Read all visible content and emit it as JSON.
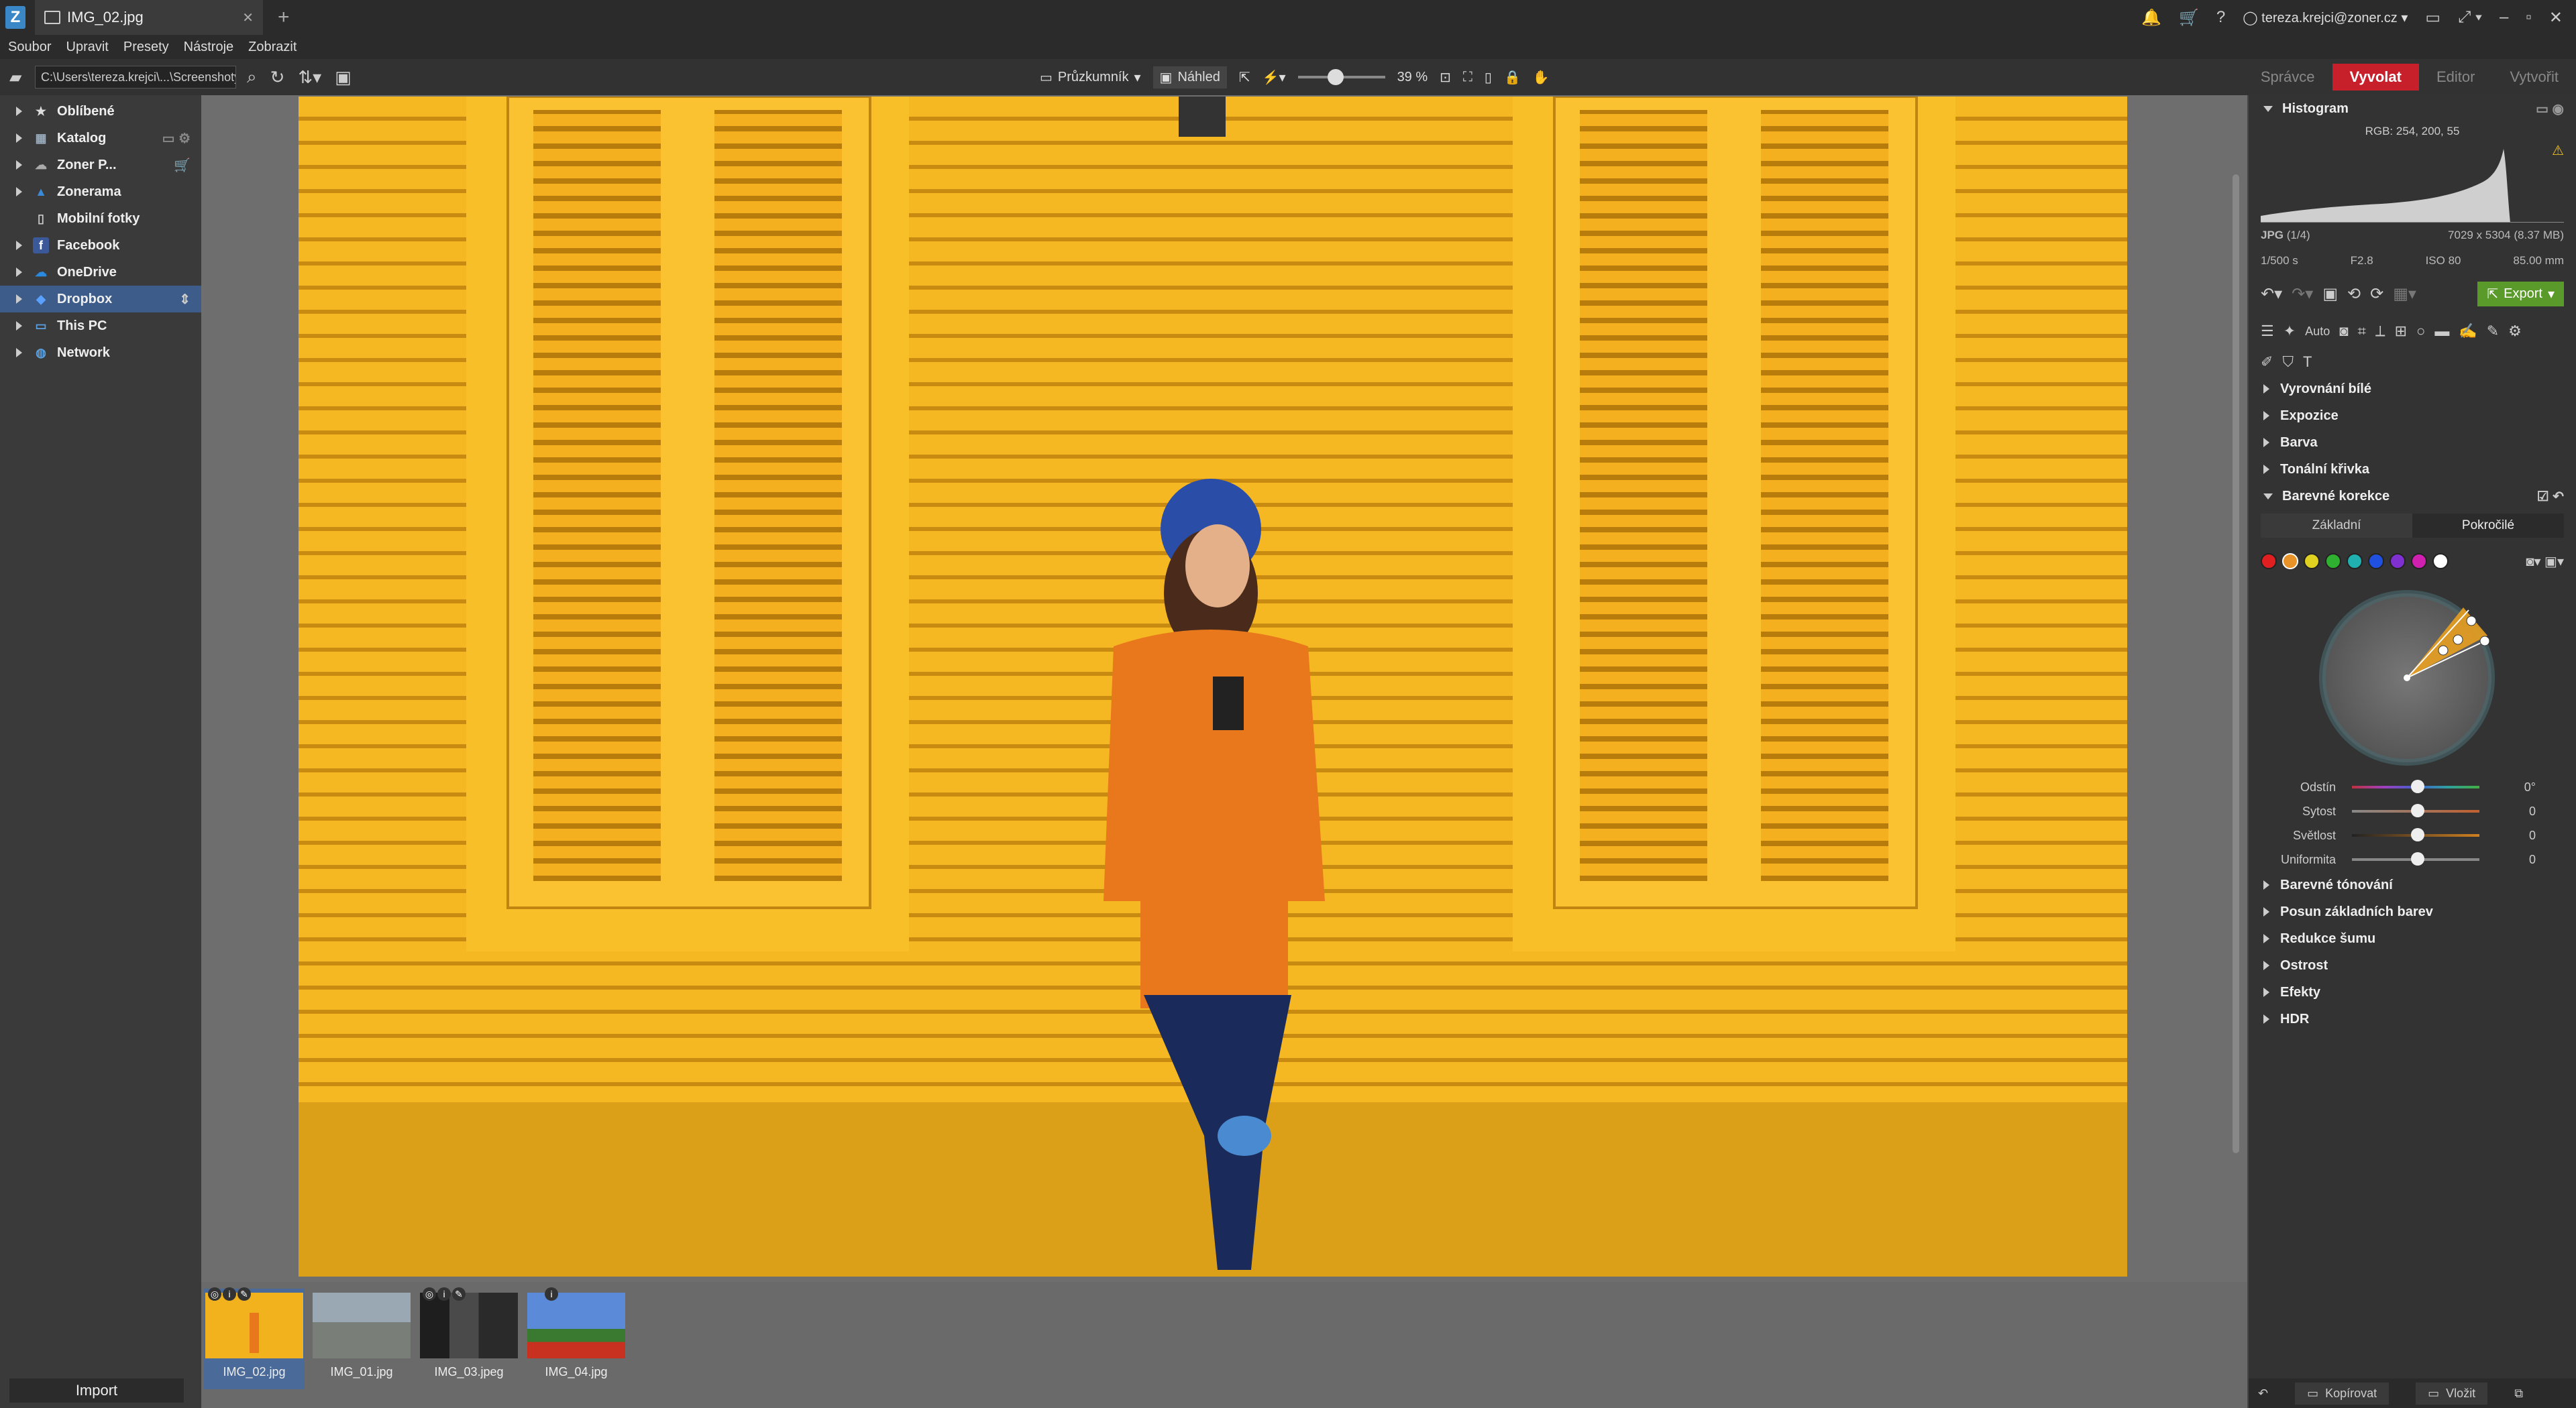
{
  "window": {
    "tab_title": "IMG_02.jpg",
    "user": "tereza.krejci@zoner.cz"
  },
  "menu": [
    "Soubor",
    "Upravit",
    "Presety",
    "Nástroje",
    "Zobrazit"
  ],
  "toolbar": {
    "path": "C:\\Users\\tereza.krejci\\...\\Screenshoty",
    "explorer_label": "Průzkumník",
    "preview_label": "Náhled",
    "zoom": "39 %"
  },
  "modes": [
    "Správce",
    "Vyvolat",
    "Editor",
    "Vytvořit"
  ],
  "active_mode": "Vyvolat",
  "navigator": [
    {
      "label": "Oblíbené",
      "icon": "star-icon"
    },
    {
      "label": "Katalog",
      "icon": "catalog-icon"
    },
    {
      "label": "Zoner P...",
      "icon": "cloud-icon"
    },
    {
      "label": "Zonerama",
      "icon": "zonerama-icon"
    },
    {
      "label": "Mobilní fotky",
      "icon": "phone-icon"
    },
    {
      "label": "Facebook",
      "icon": "facebook-icon"
    },
    {
      "label": "OneDrive",
      "icon": "onedrive-icon"
    },
    {
      "label": "Dropbox",
      "icon": "dropbox-icon"
    },
    {
      "label": "This PC",
      "icon": "pc-icon"
    },
    {
      "label": "Network",
      "icon": "network-icon"
    }
  ],
  "import_label": "Import",
  "filmstrip": [
    {
      "label": "IMG_02.jpg"
    },
    {
      "label": "IMG_01.jpg"
    },
    {
      "label": "IMG_03.jpeg"
    },
    {
      "label": "IMG_04.jpg"
    }
  ],
  "histogram": {
    "title": "Histogram",
    "rgb": "RGB: 254, 200, 55"
  },
  "file_info": {
    "type": "JPG",
    "index": "(1/4)",
    "dimensions": "7029 x 5304 (8.37 MB)",
    "shutter": "1/500 s",
    "aperture": "F2.8",
    "iso": "ISO 80",
    "focal": "85.00 mm"
  },
  "export_label": "Export",
  "auto_label": "Auto",
  "sections_top": [
    "Vyrovnání bílé",
    "Expozice",
    "Barva",
    "Tonální křivka"
  ],
  "color_correction": {
    "title": "Barevné korekce",
    "tab_basic": "Základní",
    "tab_advanced": "Pokročilé",
    "swatch_colors": [
      "#e02020",
      "#e8922a",
      "#e0d020",
      "#30b030",
      "#20b0b0",
      "#2050e0",
      "#8030d0",
      "#d020b0",
      "#ffffff"
    ],
    "sliders": [
      {
        "name": "Odstín",
        "value": "0°"
      },
      {
        "name": "Sytost",
        "value": "0"
      },
      {
        "name": "Světlost",
        "value": "0"
      },
      {
        "name": "Uniformita",
        "value": "0"
      }
    ]
  },
  "sections_bottom": [
    "Barevné tónování",
    "Posun základních barev",
    "Redukce šumu",
    "Ostrost",
    "Efekty",
    "HDR"
  ],
  "bottom_buttons": {
    "copy": "Kopírovat",
    "paste": "Vložit"
  }
}
